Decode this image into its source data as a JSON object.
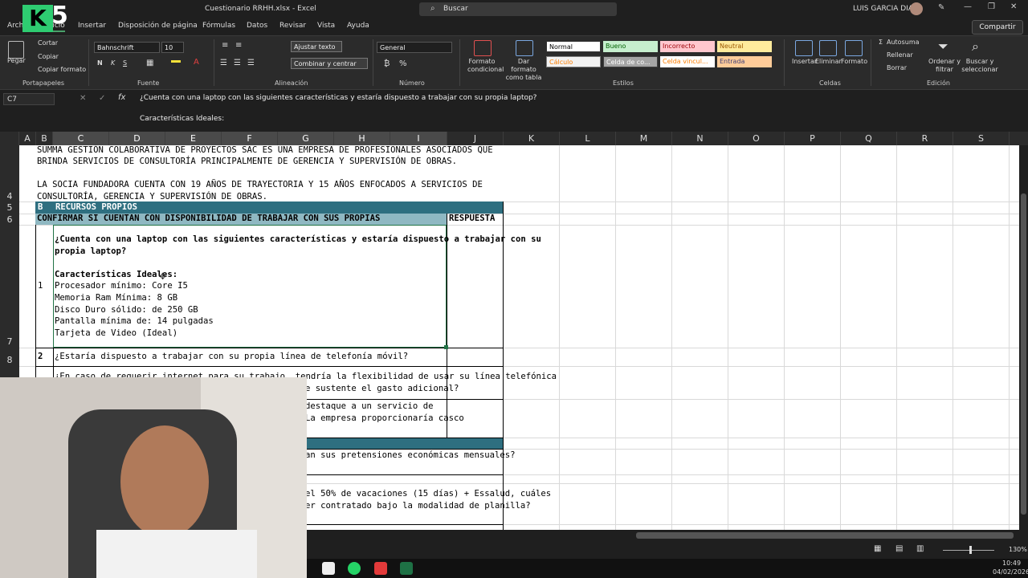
{
  "window": {
    "title": "Cuestionario RRHH.xlsx  -  Excel",
    "search_placeholder": "Buscar",
    "user": "LUIS GARCIA DIAZ"
  },
  "tabs": [
    "Archivo",
    "Inicio",
    "Insertar",
    "Disposición de página",
    "Fórmulas",
    "Datos",
    "Revisar",
    "Vista",
    "Ayuda"
  ],
  "share_label": "Compartir",
  "ribbon": {
    "clipboard": {
      "paste": "Pegar",
      "cut": "Cortar",
      "copy": "Copiar",
      "format_painter": "Copiar formato",
      "group": "Portapapeles"
    },
    "font": {
      "name": "Bahnschrift",
      "size": "10",
      "bold": "N",
      "italic": "K",
      "underline": "S",
      "group": "Fuente"
    },
    "alignment": {
      "wrap": "Ajustar texto",
      "merge": "Combinar y centrar",
      "group": "Alineación"
    },
    "number": {
      "format": "General",
      "group": "Número"
    },
    "styles": {
      "conditional": "Formato condicional",
      "as_table": "Dar formato como tabla",
      "cells": [
        "Normal",
        "Bueno",
        "Incorrecto",
        "Neutral",
        "Cálculo",
        "Celda de co...",
        "Celda vincul...",
        "Entrada"
      ],
      "group": "Estilos"
    },
    "cells": {
      "insert": "Insertar",
      "delete": "Eliminar",
      "format": "Formato",
      "group": "Celdas"
    },
    "editing": {
      "autosum": "Autosuma",
      "fill": "Rellenar",
      "clear": "Borrar",
      "sort": "Ordenar y filtrar",
      "find": "Buscar y seleccionar",
      "group": "Edición"
    }
  },
  "formula_bar": {
    "name_box": "C7",
    "fx": "fx",
    "line1": "¿Cuenta con una laptop con las siguientes características y estaría dispuesto a trabajar con su propia laptop?",
    "line2": "Características Ideales:"
  },
  "columns": [
    "A",
    "B",
    "C",
    "D",
    "E",
    "F",
    "G",
    "H",
    "I",
    "J",
    "K",
    "L",
    "M",
    "N",
    "O",
    "P",
    "Q",
    "R",
    "S"
  ],
  "rows": [
    "4",
    "5",
    "6",
    "7",
    "8"
  ],
  "sheet": {
    "intro1": "SUMMA GESTIÓN COLABORATIVA DE PROYECTOS SAC ES UNA EMPRESA DE PROFESIONALES ASOCIADOS QUE",
    "intro2": "BRINDA SERVICIOS DE CONSULTORÍA PRINCIPALMENTE DE GERENCIA Y SUPERVISIÓN DE OBRAS.",
    "intro3": "LA SOCIA FUNDADORA CUENTA CON 19 AÑOS DE TRAYECTORIA Y 15 AÑOS ENFOCADOS A SERVICIOS DE",
    "intro4": "CONSULTORÍA, GERENCIA Y SUPERVISIÓN DE OBRAS.",
    "section_letter": "B",
    "section_title": "RECURSOS PROPIOS",
    "confirm": "CONFIRMAR SI CUENTAN CON DISPONIBILIDAD DE TRABAJAR CON SUS PROPIAS",
    "answer_header": "RESPUESTA",
    "q1_num": "1",
    "q1_line1": "¿Cuenta con una laptop con las siguientes características y estaría dispuesto a trabajar con su",
    "q1_line2": "propia laptop?",
    "q1_ideal": "Características Ideales:",
    "q1_specs": [
      "Procesador mínimo: Core I5",
      "Memoria Ram Mínima: 8 GB",
      "Disco Duro sólido: de 250 GB",
      "Pantalla mínima de: 14 pulgadas",
      "Tarjeta de Video (Ideal)"
    ],
    "q2_num": "2",
    "q2": "¿Estaría dispuesto a trabajar con su propia línea de telefonía móvil?",
    "q3a": "¿En caso de requerir internet para su trabajo, tendría la flexibilidad de usar su línea telefónica",
    "q3b": "e sustente el gasto adicional?",
    "q4a": "destaque a un servicio de",
    "q4b": "La empresa proporcionaría casco",
    "q5": "an sus pretensiones económicas mensuales?",
    "q6a": "el 50% de vacaciones (15 días) + Essalud, cuáles",
    "q6b": "er contratado bajo la modalidad de planilla?"
  },
  "status": {
    "zoom": "130%"
  },
  "clock": {
    "time": "10:49",
    "date": "04/02/2026"
  },
  "colors": {
    "header_band": "#2e6f80",
    "header_band_light": "#8fb8c2",
    "accent": "#4aa06a"
  }
}
